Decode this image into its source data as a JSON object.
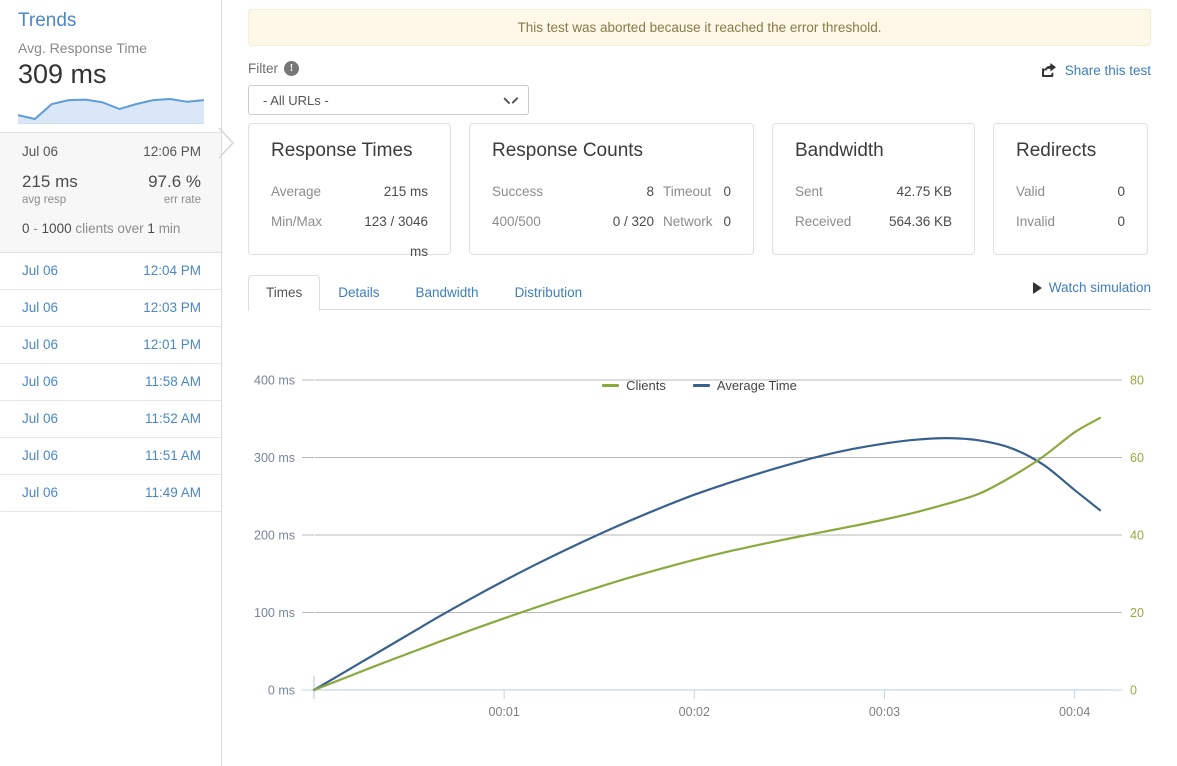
{
  "sidebar": {
    "title": "Trends",
    "metric_label": "Avg. Response Time",
    "metric_value": "309 ms",
    "sparkline_points": [
      185,
      178,
      205,
      212,
      213,
      208,
      196,
      205,
      212,
      214,
      209,
      212
    ],
    "selected": {
      "date": "Jul 06",
      "time": "12:06 PM",
      "avg_resp_value": "215 ms",
      "avg_resp_label": "avg resp",
      "err_rate_value": "97.6 %",
      "err_rate_label": "err rate",
      "clients_from": "0",
      "clients_dash": "-",
      "clients_to": "1000",
      "clients_mid": "clients over",
      "clients_dur": "1",
      "clients_unit": "min"
    },
    "items": [
      {
        "date": "Jul 06",
        "time": "12:04 PM"
      },
      {
        "date": "Jul 06",
        "time": "12:03 PM"
      },
      {
        "date": "Jul 06",
        "time": "12:01 PM"
      },
      {
        "date": "Jul 06",
        "time": "11:58 AM"
      },
      {
        "date": "Jul 06",
        "time": "11:52 AM"
      },
      {
        "date": "Jul 06",
        "time": "11:51 AM"
      },
      {
        "date": "Jul 06",
        "time": "11:49 AM"
      }
    ]
  },
  "alert": {
    "message": "This test was aborted because it reached the error threshold."
  },
  "filter": {
    "label": "Filter",
    "info_glyph": "!",
    "selected_value": "- All URLs -",
    "options": [
      "- All URLs -"
    ]
  },
  "share": {
    "label": "Share this test",
    "icon": "share-icon"
  },
  "cards": {
    "response_times": {
      "title": "Response Times",
      "rows": [
        {
          "key": "Average",
          "value": "215 ms"
        },
        {
          "key": "Min/Max",
          "value": "123 / 3046 ms"
        }
      ]
    },
    "response_counts": {
      "title": "Response Counts",
      "rows": [
        {
          "key1": "Success",
          "value1": "8",
          "key2": "Timeout",
          "value2": "0"
        },
        {
          "key1": "400/500",
          "value1": "0 / 320",
          "key2": "Network",
          "value2": "0"
        }
      ]
    },
    "bandwidth": {
      "title": "Bandwidth",
      "rows": [
        {
          "key": "Sent",
          "value": "42.75 KB"
        },
        {
          "key": "Received",
          "value": "564.36 KB"
        }
      ]
    },
    "redirects": {
      "title": "Redirects",
      "rows": [
        {
          "key": "Valid",
          "value": "0"
        },
        {
          "key": "Invalid",
          "value": "0"
        }
      ]
    }
  },
  "tabs": [
    {
      "label": "Times",
      "active": true
    },
    {
      "label": "Details",
      "active": false
    },
    {
      "label": "Bandwidth",
      "active": false
    },
    {
      "label": "Distribution",
      "active": false
    }
  ],
  "watch": {
    "label": "Watch simulation",
    "icon": "play-icon"
  },
  "colors": {
    "clients": "#8ba93f",
    "average_time": "#39618f",
    "link": "#3d7ebd",
    "grid": "#b8b8b8",
    "axis": "#c8d8ea"
  },
  "chart_data": {
    "type": "line",
    "title": "",
    "xlabel": "",
    "ylabel": "",
    "grid": true,
    "legend_position": "bottom",
    "x_ticks": [
      "00:01",
      "00:02",
      "00:03",
      "00:04"
    ],
    "x_tick_values": [
      60,
      120,
      180,
      240
    ],
    "xlim": [
      0,
      248
    ],
    "left_axis": {
      "name": "Average Time",
      "unit": "ms",
      "ticks": [
        "0 ms",
        "100 ms",
        "200 ms",
        "300 ms",
        "400 ms"
      ],
      "tick_values": [
        0,
        100,
        200,
        300,
        400
      ],
      "ylim": [
        0,
        400
      ],
      "color": "#39618f"
    },
    "right_axis": {
      "name": "Clients",
      "unit": "",
      "ticks": [
        "0",
        "20",
        "40",
        "60",
        "80"
      ],
      "tick_values": [
        0,
        20,
        40,
        60,
        80
      ],
      "ylim": [
        0,
        80
      ],
      "color": "#8ba93f"
    },
    "x": [
      0,
      10,
      20,
      30,
      40,
      50,
      60,
      70,
      80,
      90,
      100,
      110,
      120,
      130,
      140,
      150,
      160,
      170,
      180,
      190,
      200,
      210,
      220,
      230,
      240,
      248
    ],
    "series": [
      {
        "name": "Average Time",
        "axis": "left",
        "color": "#39618f",
        "values": [
          0,
          24,
          48,
          72,
          96,
          119,
          141,
          162,
          182,
          201,
          219,
          236,
          252,
          266,
          279,
          291,
          302,
          311,
          318,
          323,
          325,
          322,
          312,
          291,
          258,
          232
        ]
      },
      {
        "name": "Clients",
        "axis": "right",
        "color": "#8ba93f",
        "values": [
          0,
          3.2,
          6.4,
          9.5,
          12.6,
          15.6,
          18.5,
          21.3,
          24.0,
          26.6,
          29.1,
          31.4,
          33.6,
          35.6,
          37.4,
          39.1,
          40.7,
          42.3,
          44.0,
          45.9,
          48.1,
          50.7,
          55.0,
          60.2,
          66.5,
          70.2
        ]
      }
    ],
    "legend": [
      {
        "label": "Clients",
        "color": "#8ba93f"
      },
      {
        "label": "Average Time",
        "color": "#39618f"
      }
    ]
  }
}
